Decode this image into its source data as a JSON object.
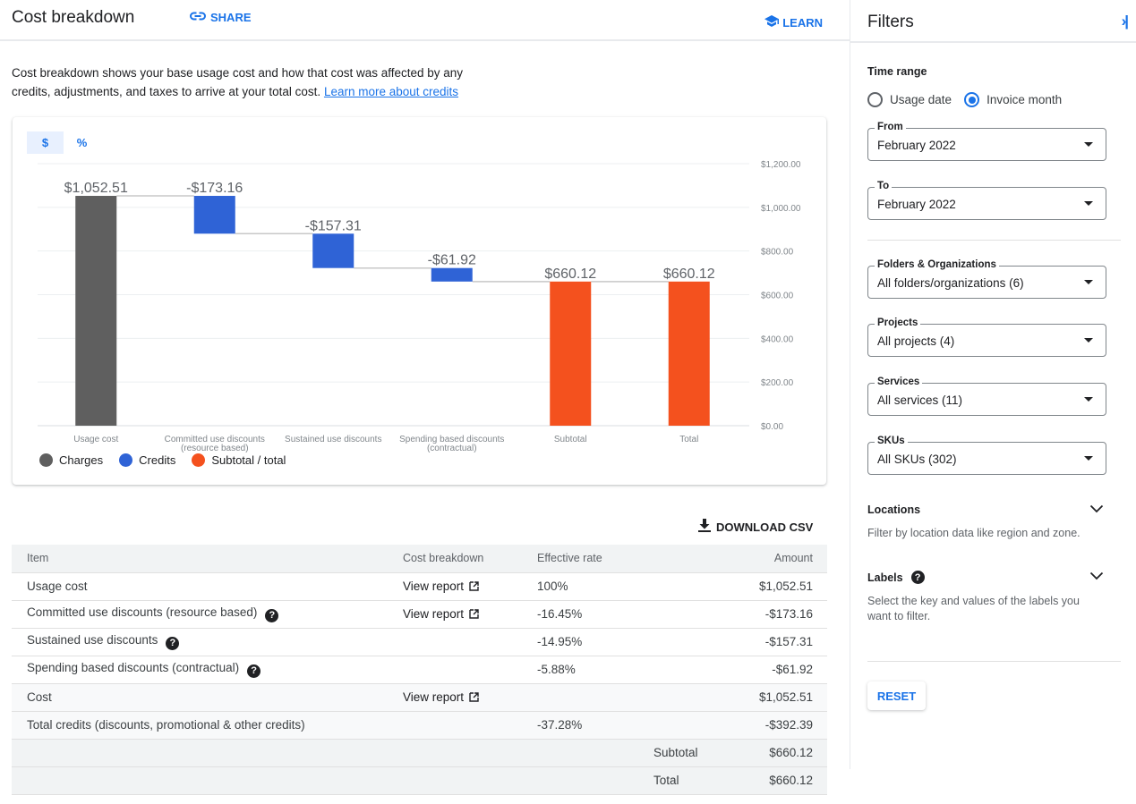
{
  "header": {
    "title": "Cost breakdown",
    "share_label": "SHARE",
    "learn_label": "LEARN"
  },
  "description": {
    "text": "Cost breakdown shows your base usage cost and how that cost was affected by any credits, adjustments, and taxes to arrive at your total cost.",
    "link_label": "Learn more about credits"
  },
  "chart_toggle": {
    "options": [
      "$",
      "%"
    ],
    "selected": "$"
  },
  "colors": {
    "charges": "#5f5f5f",
    "credits": "#2f63d6",
    "subtotal": "#f4511e",
    "accent": "#1a73e8"
  },
  "chart_data": {
    "type": "bar",
    "subtype": "waterfall",
    "title": "",
    "xlabel": "",
    "ylabel": "",
    "ylim": [
      0,
      1200
    ],
    "grid": true,
    "y_axis_position": "right",
    "yticks": [
      0,
      200,
      400,
      600,
      800,
      1000,
      1200
    ],
    "ytick_labels": [
      "$0.00",
      "$200.00",
      "$400.00",
      "$600.00",
      "$800.00",
      "$1,000.00",
      "$1,200.00"
    ],
    "categories": [
      [
        "Usage cost"
      ],
      [
        "Committed use discounts",
        "(resource based)"
      ],
      [
        "Sustained use discounts"
      ],
      [
        "Spending based discounts",
        "(contractual)"
      ],
      [
        "Subtotal"
      ],
      [
        "Total"
      ]
    ],
    "bars": [
      {
        "kind": "charges",
        "start": 0,
        "end": 1052.51,
        "label": "$1,052.51"
      },
      {
        "kind": "credits",
        "start": 1052.51,
        "end": 879.35,
        "label": "-$173.16"
      },
      {
        "kind": "credits",
        "start": 879.35,
        "end": 722.04,
        "label": "-$157.31"
      },
      {
        "kind": "credits",
        "start": 722.04,
        "end": 660.12,
        "label": "-$61.92"
      },
      {
        "kind": "subtotal",
        "start": 0,
        "end": 660.12,
        "label": "$660.12"
      },
      {
        "kind": "subtotal",
        "start": 0,
        "end": 660.12,
        "label": "$660.12"
      }
    ],
    "legend_position": "bottom-left",
    "legend": [
      {
        "name": "Charges",
        "kind": "charges"
      },
      {
        "name": "Credits",
        "kind": "credits"
      },
      {
        "name": "Subtotal / total",
        "kind": "subtotal"
      }
    ]
  },
  "download_label": "DOWNLOAD CSV",
  "table": {
    "headers": [
      "Item",
      "Cost breakdown",
      "Effective rate",
      "Amount"
    ],
    "rows": [
      {
        "item": "Usage cost",
        "help": false,
        "report": "View report",
        "rate": "100%",
        "amount": "$1,052.51"
      },
      {
        "item": "Committed use discounts (resource based)",
        "help": true,
        "report": "View report",
        "rate": "-16.45%",
        "amount": "-$173.16"
      },
      {
        "item": "Sustained use discounts",
        "help": true,
        "report": "",
        "rate": "-14.95%",
        "amount": "-$157.31"
      },
      {
        "item": "Spending based discounts (contractual)",
        "help": true,
        "report": "",
        "rate": "-5.88%",
        "amount": "-$61.92"
      },
      {
        "item": "Cost",
        "help": false,
        "report": "View report",
        "rate": "",
        "amount": "$1,052.51"
      },
      {
        "item": "Total credits (discounts, promotional & other credits)",
        "help": false,
        "report": "",
        "rate": "-37.28%",
        "amount": "-$392.39"
      }
    ],
    "summary": [
      {
        "label": "Subtotal",
        "amount": "$660.12"
      },
      {
        "label": "Total",
        "amount": "$660.12"
      }
    ]
  },
  "filters": {
    "title": "Filters",
    "time_range": {
      "label": "Time range",
      "options": [
        "Usage date",
        "Invoice month"
      ],
      "selected": "Invoice month"
    },
    "from": {
      "label": "From",
      "value": "February 2022"
    },
    "to": {
      "label": "To",
      "value": "February 2022"
    },
    "folders": {
      "label": "Folders & Organizations",
      "value": "All folders/organizations (6)"
    },
    "projects": {
      "label": "Projects",
      "value": "All projects (4)"
    },
    "services": {
      "label": "Services",
      "value": "All services (11)"
    },
    "skus": {
      "label": "SKUs",
      "value": "All SKUs (302)"
    },
    "locations": {
      "title": "Locations",
      "description": "Filter by location data like region and zone."
    },
    "labels": {
      "title": "Labels",
      "description": "Select the key and values of the labels you want to filter."
    },
    "reset_label": "RESET"
  }
}
